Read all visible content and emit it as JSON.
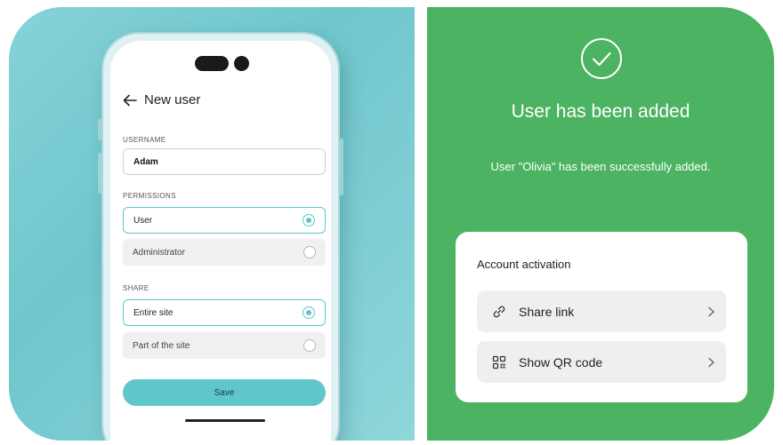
{
  "new_user_form": {
    "title": "New user",
    "username": {
      "label": "USERNAME",
      "value": "Adam"
    },
    "permissions": {
      "label": "PERMISSIONS",
      "options": [
        {
          "label": "User",
          "selected": true
        },
        {
          "label": "Administrator",
          "selected": false
        }
      ]
    },
    "share": {
      "label": "SHARE",
      "options": [
        {
          "label": "Entire site",
          "selected": true
        },
        {
          "label": "Part of the site",
          "selected": false
        }
      ]
    },
    "save_label": "Save"
  },
  "success_panel": {
    "title": "User has been added",
    "message": "User \"Olivia\" has been successfully added.",
    "card": {
      "title": "Account activation",
      "rows": [
        {
          "label": "Share link",
          "icon": "link-icon"
        },
        {
          "label": "Show QR code",
          "icon": "qr-code-icon"
        }
      ]
    }
  },
  "colors": {
    "accent_teal": "#5fc6cc",
    "success_green": "#4bb362",
    "background_teal": "#7ecfd4"
  }
}
